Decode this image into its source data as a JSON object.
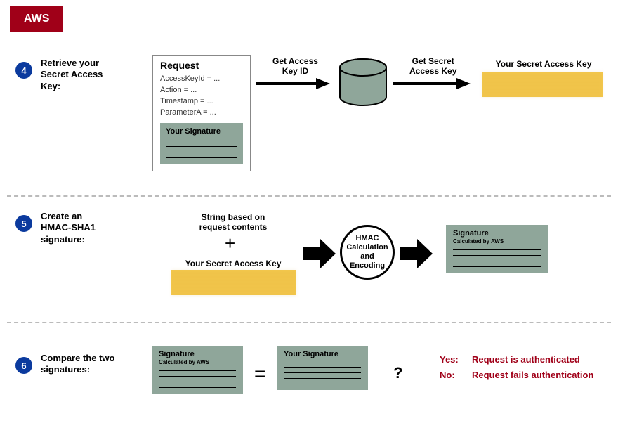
{
  "badge": "AWS",
  "step4": {
    "num": "4",
    "label": "Retrieve your\nSecret Access\nKey:",
    "request": {
      "title": "Request",
      "lines": [
        "AccessKeyId = ...",
        "Action = ...",
        "Timestamp = ...",
        "ParameterA = ..."
      ],
      "sig_title": "Your Signature"
    },
    "arrow1_label": "Get Access\nKey ID",
    "arrow2_label": "Get Secret\nAccess Key",
    "secret_label": "Your Secret Access Key"
  },
  "step5": {
    "num": "5",
    "label": "Create an\nHMAC-SHA1\nsignature:",
    "string_label": "String based on\nrequest contents",
    "plus": "+",
    "secret_label": "Your Secret Access Key",
    "hmac_label": "HMAC Calculation and Encoding",
    "sig_title": "Signature",
    "sig_sub": "Calculated by AWS"
  },
  "step6": {
    "num": "6",
    "label": "Compare the two\nsignatures:",
    "sig1_title": "Signature",
    "sig1_sub": "Calculated by AWS",
    "sig2_title": "Your Signature",
    "eq": "=",
    "q": "?",
    "yes_label": "Yes:",
    "yes_text": "Request is authenticated",
    "no_label": "No:",
    "no_text": "Request fails authentication"
  }
}
